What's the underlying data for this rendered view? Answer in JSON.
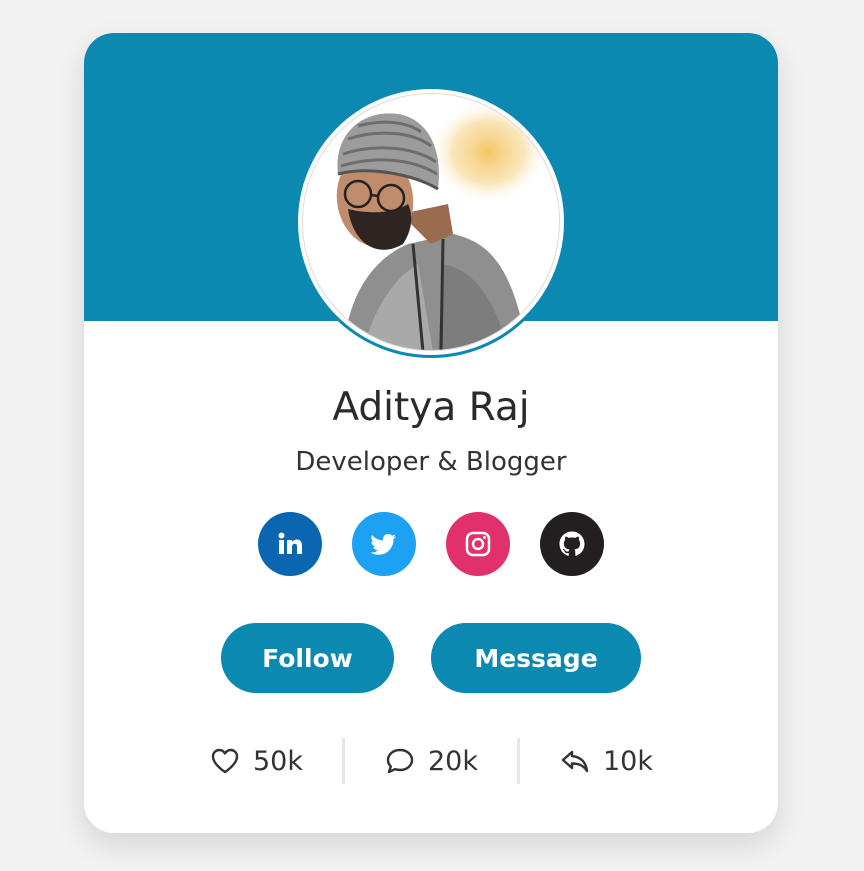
{
  "profile": {
    "name": "Aditya Raj",
    "role": "Developer & Blogger"
  },
  "colors": {
    "banner": "#0c89b0",
    "button": "#0c89b0",
    "linkedin": "#0a66b0",
    "twitter": "#1da1f2",
    "instagram": "#e1306c",
    "github": "#231f20"
  },
  "socials": [
    {
      "icon": "linkedin-icon"
    },
    {
      "icon": "twitter-icon"
    },
    {
      "icon": "instagram-icon"
    },
    {
      "icon": "github-icon"
    }
  ],
  "actions": {
    "follow_label": "Follow",
    "message_label": "Message"
  },
  "stats": {
    "likes": {
      "icon": "heart-icon",
      "value": "50k"
    },
    "comments": {
      "icon": "comment-icon",
      "value": "20k"
    },
    "shares": {
      "icon": "reply-icon",
      "value": "10k"
    }
  }
}
